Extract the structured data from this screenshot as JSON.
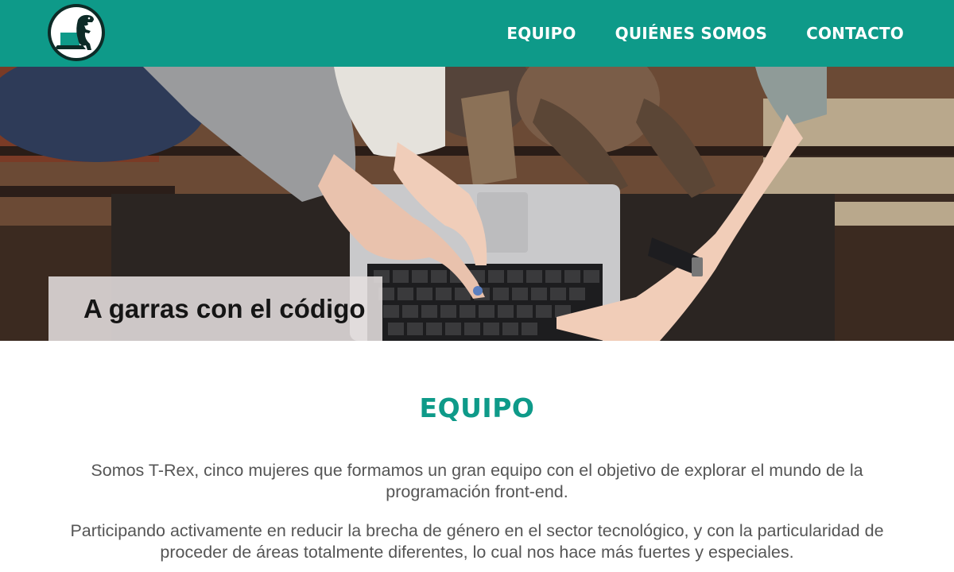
{
  "header": {
    "logo_name": "t-rex-laptop-logo",
    "nav": [
      {
        "label": "EQUIPO"
      },
      {
        "label": "QUIÉNES SOMOS"
      },
      {
        "label": "CONTACTO"
      }
    ]
  },
  "hero": {
    "image_name": "hands-on-laptop-photo",
    "caption": "A garras con el código"
  },
  "main": {
    "section_title": "EQUIPO",
    "paragraphs": [
      "Somos T-Rex, cinco mujeres que formamos un gran equipo con el objetivo de explorar el mundo de la programación front-end.",
      "Participando activamente en reducir la brecha de género en el sector tecnológico, y con la particularidad de proceder de áreas totalmente diferentes, lo cual nos hace más fuertes y especiales."
    ]
  },
  "colors": {
    "brand": "#0e9a89",
    "text": "#555555",
    "caption_bg": "#e4dede"
  }
}
